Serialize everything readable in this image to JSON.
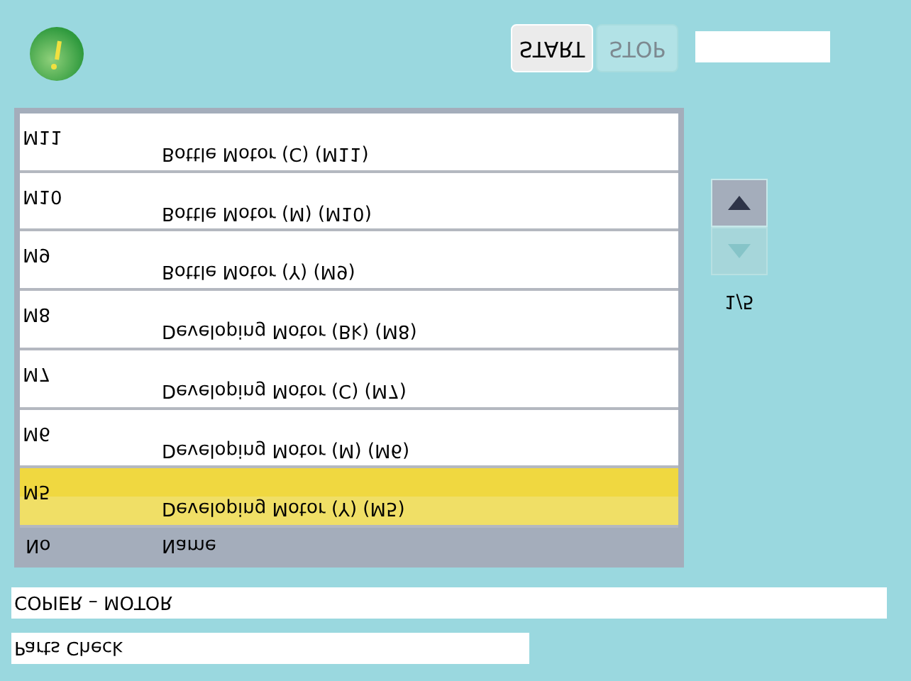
{
  "toolbar": {
    "buttons": [
      {
        "label": "START",
        "disabled": false
      },
      {
        "label": "STOP",
        "disabled": true
      }
    ]
  },
  "table": {
    "columns": [
      "No",
      "Name"
    ],
    "rows": [
      {
        "no": "M11",
        "name": "Bottle Motor (C) (M11)",
        "selected": false
      },
      {
        "no": "M10",
        "name": "Bottle Motor (M) (M10)",
        "selected": false
      },
      {
        "no": "M9",
        "name": "Bottle Motor (Y) (M9)",
        "selected": false
      },
      {
        "no": "M8",
        "name": "Developing Motor (Bk) (M8)",
        "selected": false
      },
      {
        "no": "M7",
        "name": "Developing Motor (C) (M7)",
        "selected": false
      },
      {
        "no": "M6",
        "name": "Developing Motor (M) (M6)",
        "selected": false
      },
      {
        "no": "M5",
        "name": "Developing Motor (Y) (M5)",
        "selected": true
      }
    ]
  },
  "pager": {
    "up_disabled": false,
    "down_disabled": true,
    "page": "1/5"
  },
  "path": [
    {
      "text": "COPIER – MOTOR"
    },
    {
      "text": "Parts Check"
    }
  ]
}
